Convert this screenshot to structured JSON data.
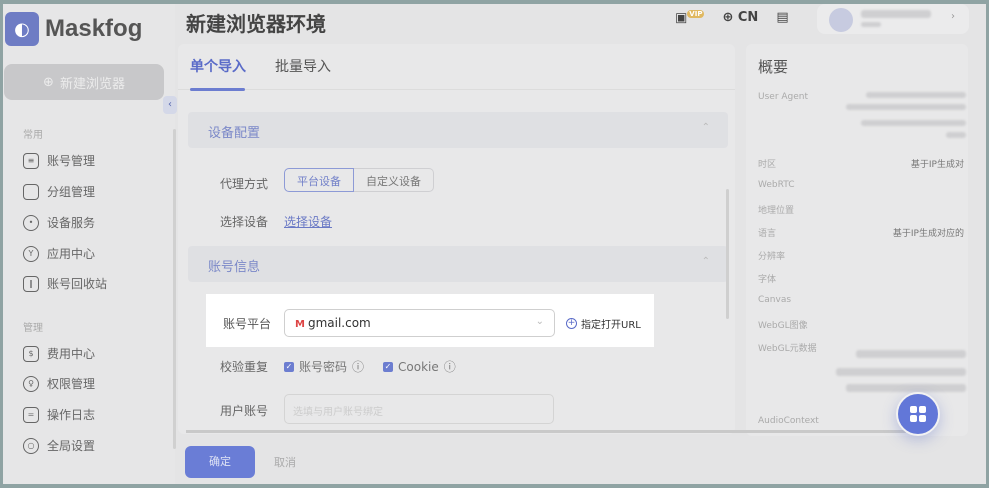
{
  "app": {
    "name": "Maskfog",
    "new_browser": "新建浏览器"
  },
  "sidebar": {
    "groups": [
      {
        "label": "常用",
        "items": [
          {
            "label": "账号管理",
            "icon": "folder-list-icon"
          },
          {
            "label": "分组管理",
            "icon": "folder-open-icon"
          },
          {
            "label": "设备服务",
            "icon": "location-pin-icon"
          },
          {
            "label": "应用中心",
            "icon": "cube-icon"
          },
          {
            "label": "账号回收站",
            "icon": "trash-icon"
          }
        ]
      },
      {
        "label": "管理",
        "items": [
          {
            "label": "费用中心",
            "icon": "billing-icon"
          },
          {
            "label": "权限管理",
            "icon": "shield-key-icon"
          },
          {
            "label": "操作日志",
            "icon": "clipboard-icon"
          },
          {
            "label": "全局设置",
            "icon": "settings-hexagon-icon"
          }
        ]
      }
    ]
  },
  "header": {
    "title": "新建浏览器环境",
    "lang": "CN",
    "vip_badge": "VIP"
  },
  "tabs": [
    {
      "label": "单个导入",
      "active": true
    },
    {
      "label": "批量导入",
      "active": false
    }
  ],
  "device_section": {
    "title": "设备配置",
    "proxy_label": "代理方式",
    "proxy_options": [
      "平台设备",
      "自定义设备"
    ],
    "proxy_selected": "平台设备",
    "select_device_label": "选择设备",
    "select_device_link": "选择设备"
  },
  "account_section": {
    "title": "账号信息",
    "platform_label": "账号平台",
    "platform_value": "gmail.com",
    "platform_icon": "M",
    "add_url": "指定打开URL",
    "check_label": "校验重复",
    "checks": [
      {
        "label": "账号密码",
        "checked": true
      },
      {
        "label": "Cookie",
        "checked": true
      }
    ],
    "user_label": "用户账号",
    "user_placeholder": "选填与用户账号绑定"
  },
  "footer": {
    "ok": "确定",
    "cancel": "取消"
  },
  "summary": {
    "title": "概要",
    "rows": [
      {
        "label": "User Agent",
        "value": ""
      },
      {
        "label": "时区",
        "value": "基于IP生成对"
      },
      {
        "label": "WebRTC",
        "value": ""
      },
      {
        "label": "地理位置",
        "value": ""
      },
      {
        "label": "语言",
        "value": "基于IP生成对应的"
      },
      {
        "label": "分辨率",
        "value": ""
      },
      {
        "label": "字体",
        "value": ""
      },
      {
        "label": "Canvas",
        "value": ""
      },
      {
        "label": "WebGL图像",
        "value": ""
      },
      {
        "label": "WebGL元数据",
        "value": ""
      },
      {
        "label": "AudioContext",
        "value": ""
      }
    ]
  },
  "colors": {
    "accent": "#6a7dd6",
    "frame": "#8fa3a3"
  }
}
